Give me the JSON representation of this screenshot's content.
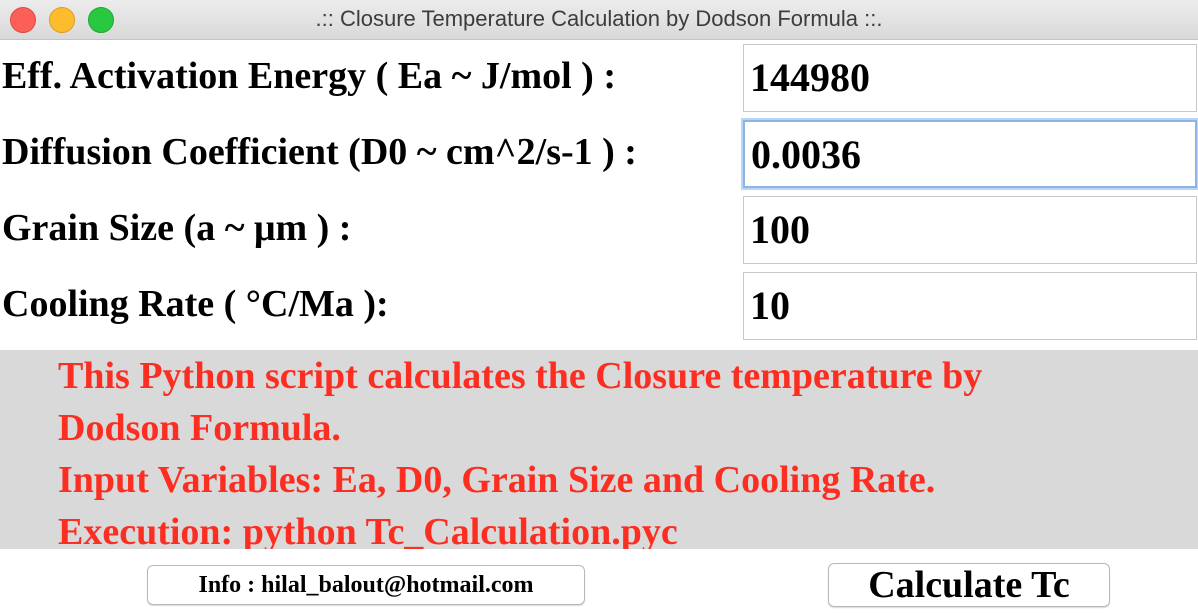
{
  "window": {
    "title": ".:: Closure Temperature Calculation by Dodson Formula ::."
  },
  "form": {
    "fields": [
      {
        "label": "Eff. Activation Energy ( Ea ~ J/mol ) :",
        "value": "144980"
      },
      {
        "label": "Diffusion Coefficient (D0 ~ cm^2/s-1 ) :",
        "value": "0.0036"
      },
      {
        "label": "Grain Size (a ~ μm ) :",
        "value": "100"
      },
      {
        "label": "Cooling Rate ( °C/Ma ):",
        "value": "10"
      }
    ],
    "focused_field_index": 1
  },
  "info": {
    "lines": [
      "This Python script calculates the Closure temperature by",
      "Dodson Formula.",
      "Input Variables: Ea, D0, Grain Size and Cooling Rate.",
      "Execution: python Tc_Calculation.pyc"
    ],
    "text_color": "#fc2d21",
    "background": "#d9d9d9"
  },
  "buttons": {
    "info_label": "Info : hilal_balout@hotmail.com",
    "calculate_label": "Calculate Tc"
  },
  "colors": {
    "close": "#fc5f57",
    "minimize": "#fdbc2e",
    "maximize": "#28c840",
    "focus_ring": "#8cb4e8"
  }
}
